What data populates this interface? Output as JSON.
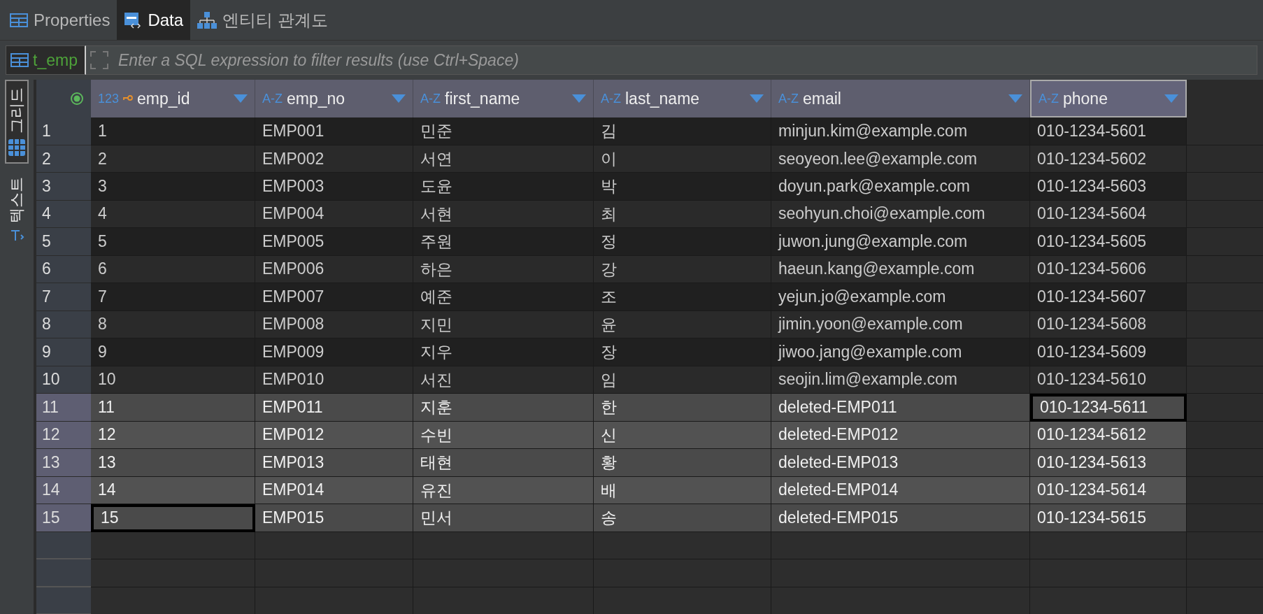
{
  "tabs": [
    {
      "label": "Properties",
      "selected": false
    },
    {
      "label": "Data",
      "selected": true
    },
    {
      "label": "엔티티 관계도",
      "selected": false
    }
  ],
  "filter": {
    "table_name": "t_emp",
    "placeholder": "Enter a SQL expression to filter results (use Ctrl+Space)"
  },
  "side_tabs": [
    {
      "label": "그리드",
      "selected": true
    },
    {
      "label": "텍스트",
      "selected": false
    }
  ],
  "table": {
    "columns": [
      {
        "type_label": "123",
        "name": "emp_id",
        "primary_key": true,
        "selected": false
      },
      {
        "type_label": "A-Z",
        "name": "emp_no",
        "primary_key": false,
        "selected": false
      },
      {
        "type_label": "A-Z",
        "name": "first_name",
        "primary_key": false,
        "selected": false
      },
      {
        "type_label": "A-Z",
        "name": "last_name",
        "primary_key": false,
        "selected": false
      },
      {
        "type_label": "A-Z",
        "name": "email",
        "primary_key": false,
        "selected": false
      },
      {
        "type_label": "A-Z",
        "name": "phone",
        "primary_key": false,
        "selected": true
      }
    ],
    "rows": [
      {
        "number": "1",
        "selected": false,
        "cells": [
          {
            "text": "1",
            "focused": false
          },
          {
            "text": "EMP001",
            "focused": false
          },
          {
            "text": "민준",
            "focused": false
          },
          {
            "text": "김",
            "focused": false
          },
          {
            "text": "minjun.kim@example.com",
            "focused": false
          },
          {
            "text": "010-1234-5601",
            "focused": false
          }
        ]
      },
      {
        "number": "2",
        "selected": false,
        "cells": [
          {
            "text": "2",
            "focused": false
          },
          {
            "text": "EMP002",
            "focused": false
          },
          {
            "text": "서연",
            "focused": false
          },
          {
            "text": "이",
            "focused": false
          },
          {
            "text": "seoyeon.lee@example.com",
            "focused": false
          },
          {
            "text": "010-1234-5602",
            "focused": false
          }
        ]
      },
      {
        "number": "3",
        "selected": false,
        "cells": [
          {
            "text": "3",
            "focused": false
          },
          {
            "text": "EMP003",
            "focused": false
          },
          {
            "text": "도윤",
            "focused": false
          },
          {
            "text": "박",
            "focused": false
          },
          {
            "text": "doyun.park@example.com",
            "focused": false
          },
          {
            "text": "010-1234-5603",
            "focused": false
          }
        ]
      },
      {
        "number": "4",
        "selected": false,
        "cells": [
          {
            "text": "4",
            "focused": false
          },
          {
            "text": "EMP004",
            "focused": false
          },
          {
            "text": "서현",
            "focused": false
          },
          {
            "text": "최",
            "focused": false
          },
          {
            "text": "seohyun.choi@example.com",
            "focused": false
          },
          {
            "text": "010-1234-5604",
            "focused": false
          }
        ]
      },
      {
        "number": "5",
        "selected": false,
        "cells": [
          {
            "text": "5",
            "focused": false
          },
          {
            "text": "EMP005",
            "focused": false
          },
          {
            "text": "주원",
            "focused": false
          },
          {
            "text": "정",
            "focused": false
          },
          {
            "text": "juwon.jung@example.com",
            "focused": false
          },
          {
            "text": "010-1234-5605",
            "focused": false
          }
        ]
      },
      {
        "number": "6",
        "selected": false,
        "cells": [
          {
            "text": "6",
            "focused": false
          },
          {
            "text": "EMP006",
            "focused": false
          },
          {
            "text": "하은",
            "focused": false
          },
          {
            "text": "강",
            "focused": false
          },
          {
            "text": "haeun.kang@example.com",
            "focused": false
          },
          {
            "text": "010-1234-5606",
            "focused": false
          }
        ]
      },
      {
        "number": "7",
        "selected": false,
        "cells": [
          {
            "text": "7",
            "focused": false
          },
          {
            "text": "EMP007",
            "focused": false
          },
          {
            "text": "예준",
            "focused": false
          },
          {
            "text": "조",
            "focused": false
          },
          {
            "text": "yejun.jo@example.com",
            "focused": false
          },
          {
            "text": "010-1234-5607",
            "focused": false
          }
        ]
      },
      {
        "number": "8",
        "selected": false,
        "cells": [
          {
            "text": "8",
            "focused": false
          },
          {
            "text": "EMP008",
            "focused": false
          },
          {
            "text": "지민",
            "focused": false
          },
          {
            "text": "윤",
            "focused": false
          },
          {
            "text": "jimin.yoon@example.com",
            "focused": false
          },
          {
            "text": "010-1234-5608",
            "focused": false
          }
        ]
      },
      {
        "number": "9",
        "selected": false,
        "cells": [
          {
            "text": "9",
            "focused": false
          },
          {
            "text": "EMP009",
            "focused": false
          },
          {
            "text": "지우",
            "focused": false
          },
          {
            "text": "장",
            "focused": false
          },
          {
            "text": "jiwoo.jang@example.com",
            "focused": false
          },
          {
            "text": "010-1234-5609",
            "focused": false
          }
        ]
      },
      {
        "number": "10",
        "selected": false,
        "cells": [
          {
            "text": "10",
            "focused": false
          },
          {
            "text": "EMP010",
            "focused": false
          },
          {
            "text": "서진",
            "focused": false
          },
          {
            "text": "임",
            "focused": false
          },
          {
            "text": "seojin.lim@example.com",
            "focused": false
          },
          {
            "text": "010-1234-5610",
            "focused": false
          }
        ]
      },
      {
        "number": "11",
        "selected": true,
        "cells": [
          {
            "text": "11",
            "focused": false
          },
          {
            "text": "EMP011",
            "focused": false
          },
          {
            "text": "지훈",
            "focused": false
          },
          {
            "text": "한",
            "focused": false
          },
          {
            "text": "deleted-EMP011",
            "focused": false
          },
          {
            "text": "010-1234-5611",
            "focused": true
          }
        ]
      },
      {
        "number": "12",
        "selected": true,
        "cells": [
          {
            "text": "12",
            "focused": false
          },
          {
            "text": "EMP012",
            "focused": false
          },
          {
            "text": "수빈",
            "focused": false
          },
          {
            "text": "신",
            "focused": false
          },
          {
            "text": "deleted-EMP012",
            "focused": false
          },
          {
            "text": "010-1234-5612",
            "focused": false
          }
        ]
      },
      {
        "number": "13",
        "selected": true,
        "cells": [
          {
            "text": "13",
            "focused": false
          },
          {
            "text": "EMP013",
            "focused": false
          },
          {
            "text": "태현",
            "focused": false
          },
          {
            "text": "황",
            "focused": false
          },
          {
            "text": "deleted-EMP013",
            "focused": false
          },
          {
            "text": "010-1234-5613",
            "focused": false
          }
        ]
      },
      {
        "number": "14",
        "selected": true,
        "cells": [
          {
            "text": "14",
            "focused": false
          },
          {
            "text": "EMP014",
            "focused": false
          },
          {
            "text": "유진",
            "focused": false
          },
          {
            "text": "배",
            "focused": false
          },
          {
            "text": "deleted-EMP014",
            "focused": false
          },
          {
            "text": "010-1234-5614",
            "focused": false
          }
        ]
      },
      {
        "number": "15",
        "selected": true,
        "cells": [
          {
            "text": "15",
            "focused": true
          },
          {
            "text": "EMP015",
            "focused": false
          },
          {
            "text": "민서",
            "focused": false
          },
          {
            "text": "송",
            "focused": false
          },
          {
            "text": "deleted-EMP015",
            "focused": false
          },
          {
            "text": "010-1234-5615",
            "focused": false
          }
        ]
      }
    ]
  }
}
